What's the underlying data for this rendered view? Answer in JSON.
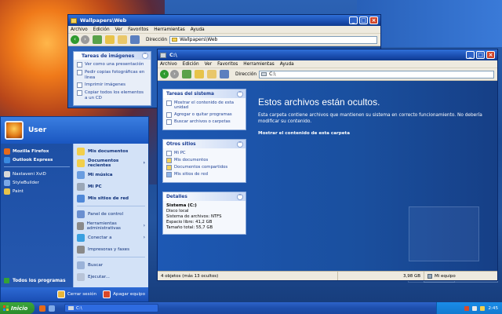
{
  "windows": {
    "back": {
      "title": "Wallpapers\\Web",
      "menu": [
        "Archivo",
        "Edición",
        "Ver",
        "Favoritos",
        "Herramientas",
        "Ayuda"
      ],
      "address_label": "Dirección",
      "address": "Wallpapers\\Web",
      "tasks_title": "Tareas de imágenes",
      "tasks": [
        "Ver como una presentación",
        "Pedir copias fotográficas en línea",
        "Imprimir imágenes",
        "Copiar todos los elementos a un CD"
      ]
    },
    "front": {
      "title": "C:\\",
      "menu": [
        "Archivo",
        "Edición",
        "Ver",
        "Favoritos",
        "Herramientas",
        "Ayuda"
      ],
      "address_label": "Dirección",
      "address": "C:\\",
      "system_tasks": {
        "title": "Tareas del sistema",
        "items": [
          "Mostrar el contenido de esta unidad",
          "Agregar o quitar programas",
          "Buscar archivos o carpetas"
        ]
      },
      "other_places": {
        "title": "Otros sitios",
        "items": [
          "Mi PC",
          "Mis documentos",
          "Documentos compartidos",
          "Mis sitios de red"
        ]
      },
      "details": {
        "title": "Detalles",
        "name": "Sistema (C:)",
        "lines": [
          "Disco local",
          "Sistema de archivos: NTFS",
          "Espacio libre: 41,2 GB",
          "Tamaño total: 55,7 GB"
        ]
      },
      "hidden_title": "Estos archivos están ocultos.",
      "hidden_desc": "Esta carpeta contiene archivos que mantienen su sistema en correcto funcionamiento. No debería modificar su contenido.",
      "hidden_link": "Mostrar el contenido de esta carpeta",
      "status": {
        "objects": "4 objetos (más 13 ocultos)",
        "size": "3,98 GB",
        "location": "Mi equipo"
      }
    }
  },
  "start_menu": {
    "user": "User",
    "pinned": [
      {
        "label": "Mozilla Firefox",
        "icon": "firefox-icon",
        "color": "#e66a1a"
      },
      {
        "label": "Outlook Express",
        "icon": "outlook-icon",
        "color": "#3a8ae0"
      }
    ],
    "recent": [
      {
        "label": "Nastaveni XviD",
        "icon": "xvid-icon",
        "color": "#d8d8d8"
      },
      {
        "label": "StyleBuilder",
        "icon": "stylebuilder-icon",
        "color": "#7aa8e8"
      },
      {
        "label": "Paint",
        "icon": "paint-icon",
        "color": "#e8c24a"
      }
    ],
    "all_programs": "Todos los programas",
    "right_items": [
      {
        "label": "Mis documentos",
        "bold": true,
        "arrow": false,
        "color": "#f2cf4c"
      },
      {
        "label": "Documentos recientes",
        "bold": true,
        "arrow": true,
        "color": "#f2cf4c"
      },
      {
        "label": "Mi música",
        "bold": true,
        "arrow": false,
        "color": "#6a9de0"
      },
      {
        "label": "Mi PC",
        "bold": true,
        "arrow": false,
        "color": "#9aa7b8"
      },
      {
        "label": "Mis sitios de red",
        "bold": true,
        "arrow": false,
        "color": "#4f88d8"
      }
    ],
    "right_items2": [
      {
        "label": "Panel de control",
        "arrow": false,
        "color": "#6a8fd0"
      },
      {
        "label": "Herramientas administrativas",
        "arrow": true,
        "color": "#8a8a8a"
      },
      {
        "label": "Conectar a",
        "arrow": true,
        "color": "#3aa0e0"
      },
      {
        "label": "Impresoras y faxes",
        "arrow": false,
        "color": "#8a8a8a"
      }
    ],
    "right_items3": [
      {
        "label": "Buscar",
        "arrow": false,
        "color": "#9ab2d8"
      },
      {
        "label": "Ejecutar...",
        "arrow": false,
        "color": "#b8c4d8"
      }
    ],
    "logoff": "Cerrar sesión",
    "shutdown": "Apagar equipo"
  },
  "taskbar": {
    "start": "Inicio",
    "task": "C:\\",
    "clock": "2:45"
  }
}
